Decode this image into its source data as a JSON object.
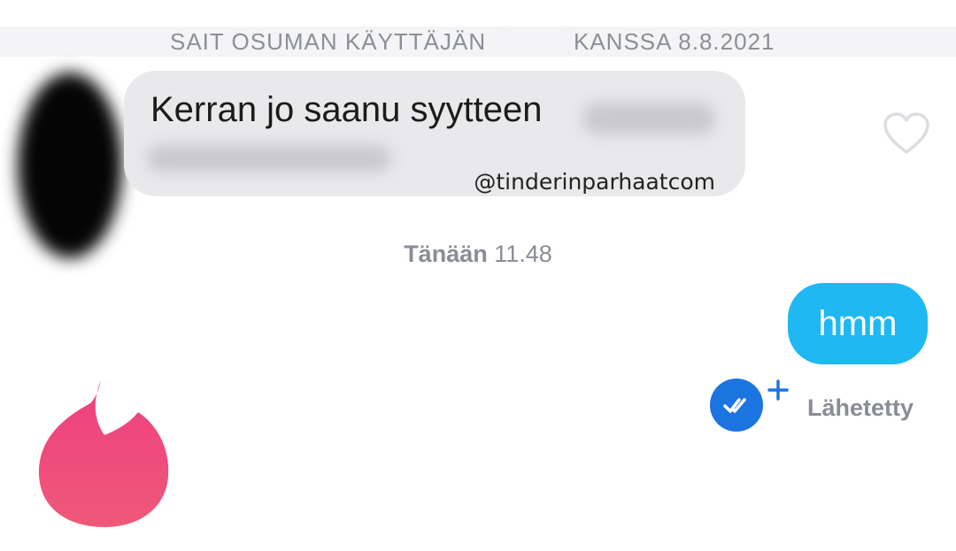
{
  "header": {
    "match_prefix": "SAIT OSUMAN KÄYTTÄJÄN",
    "match_suffix": "KANSSA 8.8.2021"
  },
  "incoming_message": {
    "text": "Kerran jo saanu syytteen",
    "watermark": "@tinderinparhaatcom"
  },
  "timestamp": {
    "day": "Tänään",
    "time": "11.48"
  },
  "outgoing_message": {
    "text": "hmm",
    "status": "Lähetetty"
  },
  "icons": {
    "like": "heart-icon",
    "read_receipt": "double-check-icon",
    "add": "plus-icon",
    "logo": "tinder-flame-icon"
  },
  "colors": {
    "outgoing_bubble": "#1fb8f2",
    "incoming_bubble": "#e9e9eb",
    "read_badge": "#1c74e0",
    "brand": "#ee4a82"
  }
}
